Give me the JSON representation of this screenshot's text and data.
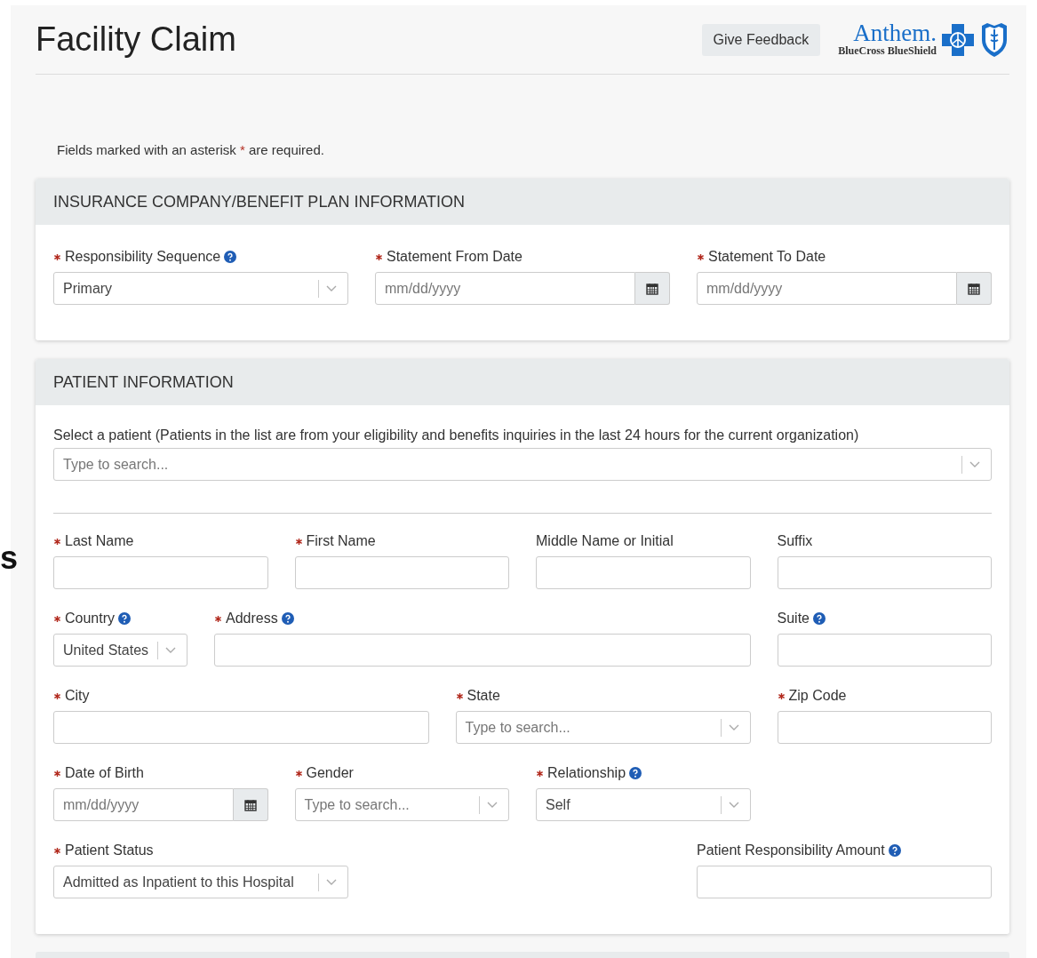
{
  "edge_fragment": "s",
  "header": {
    "title": "Facility Claim",
    "feedback_button": "Give Feedback",
    "logo": {
      "name": "Anthem.",
      "tagline": "BlueCross BlueShield"
    }
  },
  "note": {
    "before": "Fields marked with an asterisk",
    "mark": "*",
    "after": "are required."
  },
  "sections": [
    {
      "title": "INSURANCE COMPANY/BENEFIT PLAN INFORMATION",
      "rows": [
        [
          {
            "label": "Responsibility Sequence",
            "required": true,
            "help": true,
            "kind": "select",
            "value": "Primary"
          },
          {
            "label": "Statement From Date",
            "required": true,
            "help": false,
            "kind": "date",
            "placeholder": "mm/dd/yyyy"
          },
          {
            "label": "Statement To Date",
            "required": true,
            "help": false,
            "kind": "date",
            "placeholder": "mm/dd/yyyy"
          }
        ]
      ]
    },
    {
      "title": "PATIENT INFORMATION",
      "lookup": {
        "label": "Select a patient (Patients in the list are from your eligibility and benefits inquiries in the last 24 hours for the current organization)",
        "placeholder": "Type to search..."
      },
      "rows": [
        [
          {
            "label": "Last Name",
            "required": true,
            "help": false,
            "kind": "text"
          },
          {
            "label": "First Name",
            "required": true,
            "help": false,
            "kind": "text"
          },
          {
            "label": "Middle Name or Initial",
            "required": false,
            "help": false,
            "kind": "text"
          },
          {
            "label": "Suffix",
            "required": false,
            "help": false,
            "kind": "text"
          }
        ],
        [
          {
            "label": "Country",
            "required": true,
            "help": true,
            "kind": "select",
            "value": "United States"
          },
          {
            "label": "Address",
            "required": true,
            "help": true,
            "kind": "text"
          },
          {
            "label": "Suite",
            "required": false,
            "help": true,
            "kind": "text"
          }
        ],
        [
          {
            "label": "City",
            "required": true,
            "help": false,
            "kind": "text"
          },
          {
            "label": "State",
            "required": true,
            "help": false,
            "kind": "select",
            "placeholder": "Type to search..."
          },
          {
            "label": "Zip Code",
            "required": true,
            "help": false,
            "kind": "text"
          }
        ],
        [
          {
            "label": "Date of Birth",
            "required": true,
            "help": false,
            "kind": "date",
            "placeholder": "mm/dd/yyyy"
          },
          {
            "label": "Gender",
            "required": true,
            "help": false,
            "kind": "select",
            "placeholder": "Type to search..."
          },
          {
            "label": "Relationship",
            "required": true,
            "help": true,
            "kind": "select",
            "value": "Self"
          }
        ],
        [
          {
            "label": "Patient Status",
            "required": true,
            "help": false,
            "kind": "select",
            "value": "Admitted as Inpatient to this Hospital"
          },
          "",
          {
            "label": "Patient Responsibility Amount",
            "required": false,
            "help": true,
            "kind": "text"
          }
        ]
      ]
    }
  ]
}
